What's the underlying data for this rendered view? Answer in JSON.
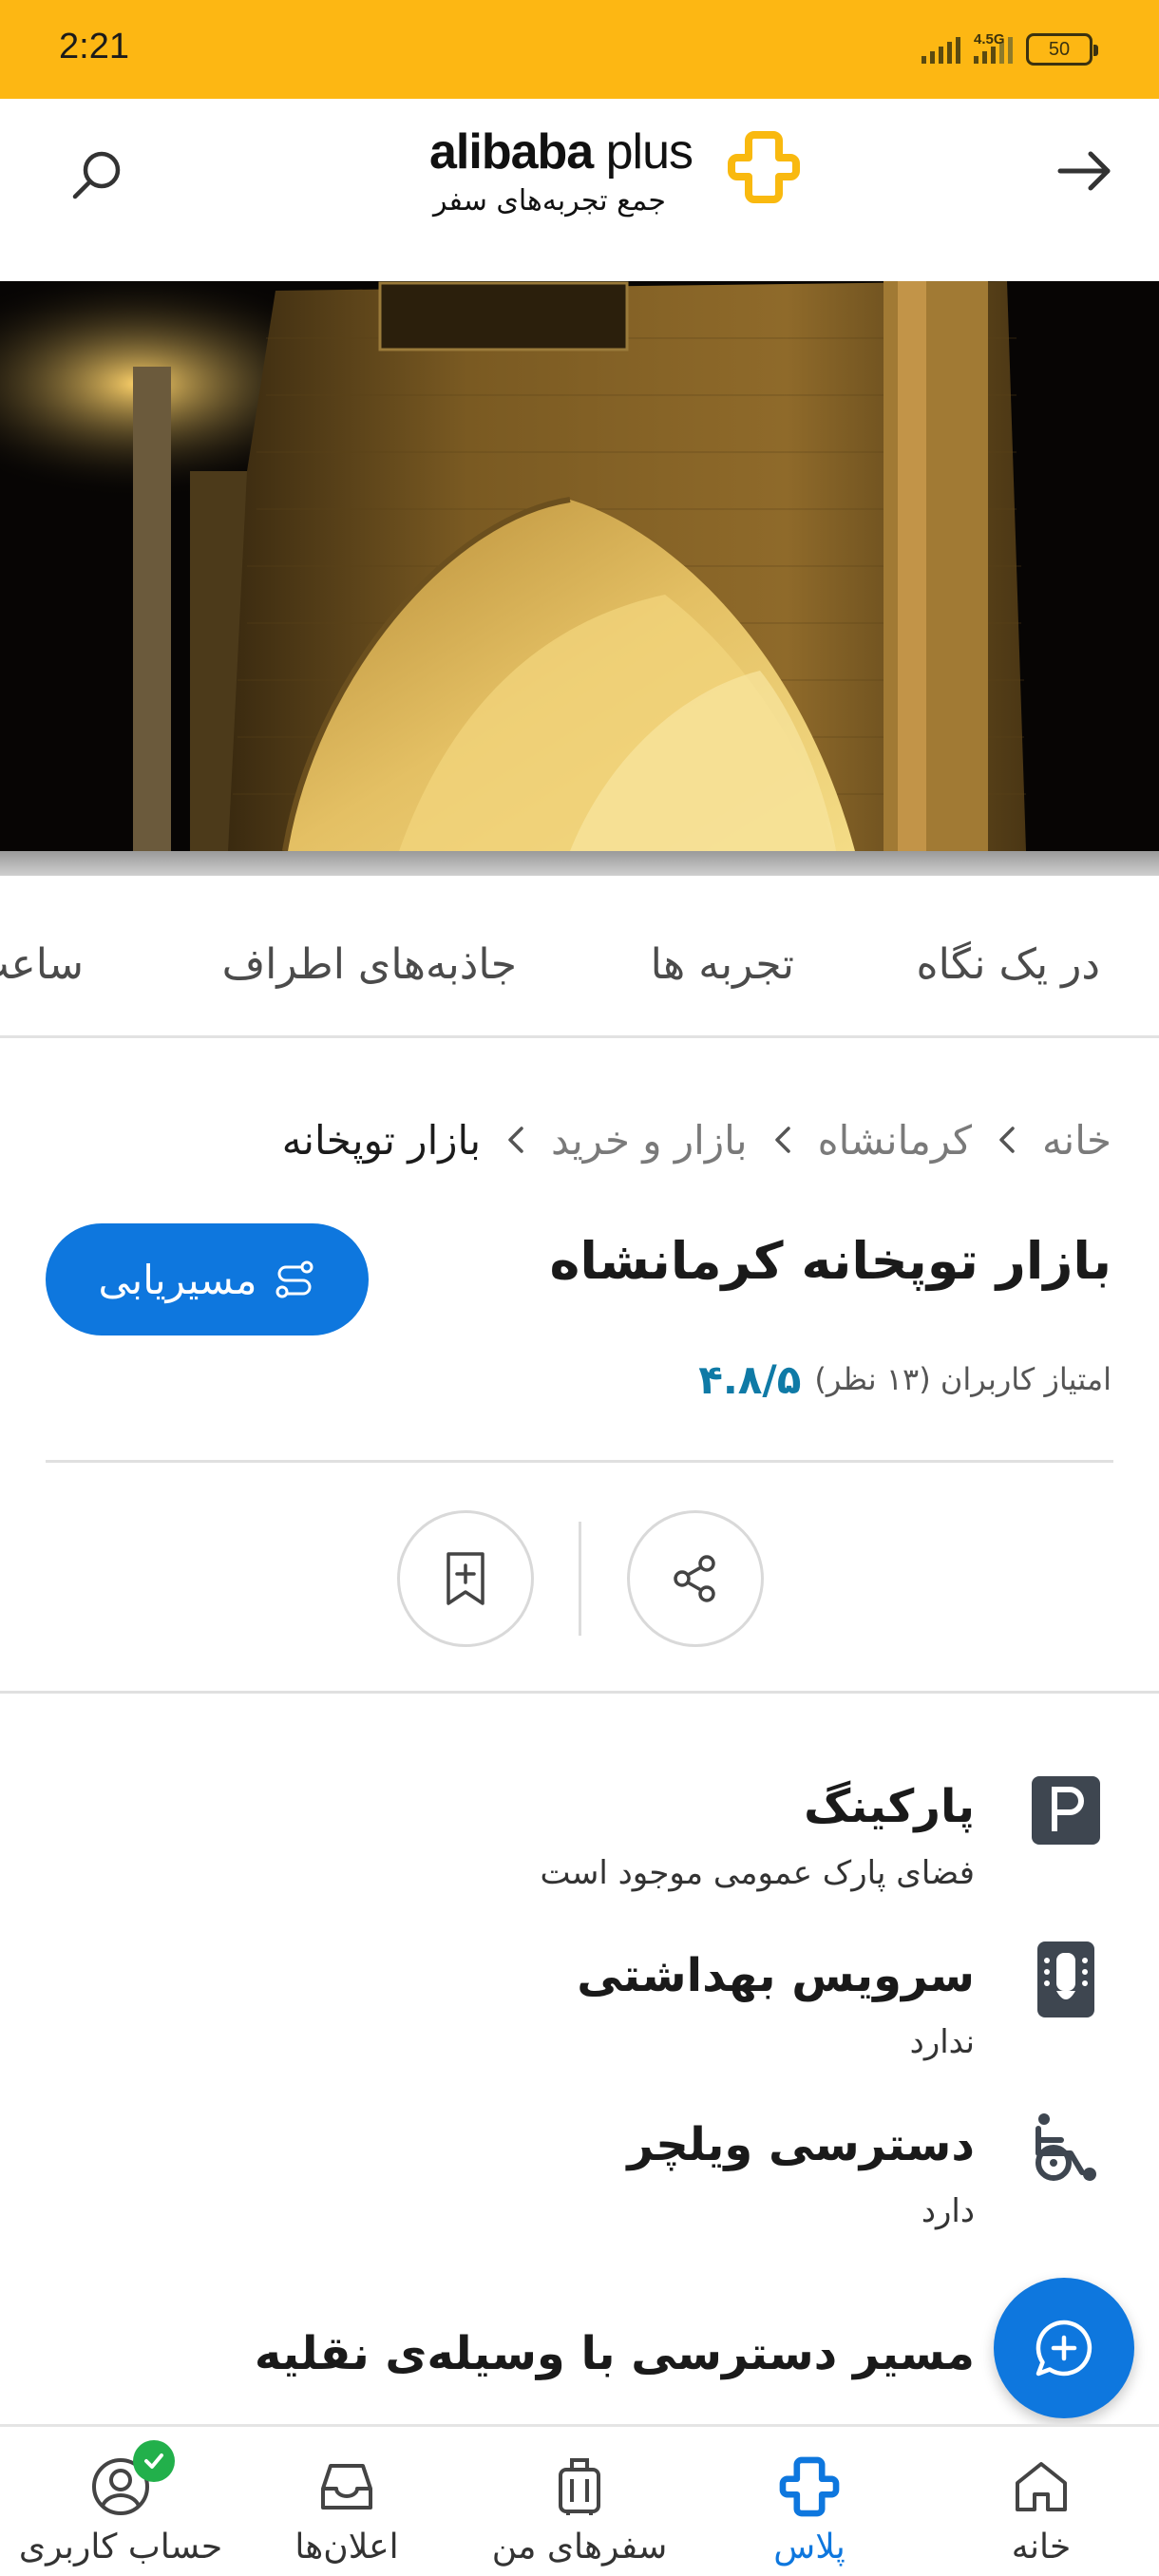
{
  "status_bar": {
    "time": "2:21",
    "network": "4.5G",
    "battery": "50"
  },
  "header": {
    "logo_word": "alibaba",
    "logo_plus": "plus",
    "logo_tagline": "جمع تجربه‌های سفر",
    "search_icon": "search-icon",
    "back_icon": "arrow-right-icon"
  },
  "tabs": [
    "در یک نگاه",
    "تجربه ها",
    "جاذبه‌های اطراف",
    "ساعت"
  ],
  "breadcrumb": [
    "خانه",
    "کرمانشاه",
    "بازار و خرید",
    "بازار توپخانه"
  ],
  "place": {
    "title": "بازار توپخانه کرمانشاه",
    "route_label": "مسیریابی",
    "rating_score": "۴.۸/۵",
    "rating_text": "امتیاز کاربران (۱۳ نظر)"
  },
  "actions": {
    "share_icon": "share-icon",
    "bookmark_icon": "bookmark-add-icon"
  },
  "amenities": [
    {
      "icon": "parking-icon",
      "title": "پارکینگ",
      "subtitle": "فضای پارک عمومی موجود است"
    },
    {
      "icon": "restroom-icon",
      "title": "سرویس بهداشتی",
      "subtitle": "ندارد"
    },
    {
      "icon": "wheelchair-icon",
      "title": "دسترسی ویلچر",
      "subtitle": "دارد"
    }
  ],
  "section_title": "مسیر دسترسی با وسیله‌ی نقلیه",
  "bottom_nav": [
    {
      "label": "خانه",
      "icon": "home-icon",
      "active": false
    },
    {
      "label": "پلاس",
      "icon": "plus-logo-icon",
      "active": true
    },
    {
      "label": "سفرهای من",
      "icon": "luggage-icon",
      "active": false
    },
    {
      "label": "اعلان‌ها",
      "icon": "inbox-icon",
      "active": false
    },
    {
      "label": "حساب کاربری",
      "icon": "account-icon",
      "active": false
    }
  ],
  "colors": {
    "status_bar": "#FDB713",
    "brand_blue": "#0E77DE",
    "rating_teal": "#0f7aa6",
    "logo_yellow": "#F9B90F"
  }
}
